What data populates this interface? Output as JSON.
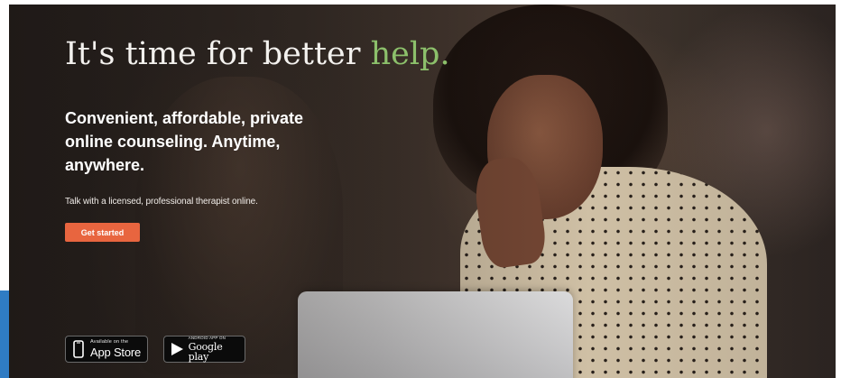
{
  "hero": {
    "headline_main": "It's time for better ",
    "headline_accent": "help.",
    "subheadline": "Convenient, affordable, private online counseling. Anytime, anywhere.",
    "tagline": "Talk with a licensed, professional therapist online.",
    "cta_label": "Get started"
  },
  "badges": {
    "apple": {
      "small_text": "Available on the",
      "big_text": "App Store",
      "icon": "phone-icon"
    },
    "google": {
      "small_text": "Android app on",
      "big_text": "Google play",
      "icon": "play-triangle-icon"
    }
  },
  "colors": {
    "accent_green": "#8cc06b",
    "cta_orange": "#e8653f",
    "edge_blue": "#2f7cc4",
    "text_white": "#ffffff"
  }
}
